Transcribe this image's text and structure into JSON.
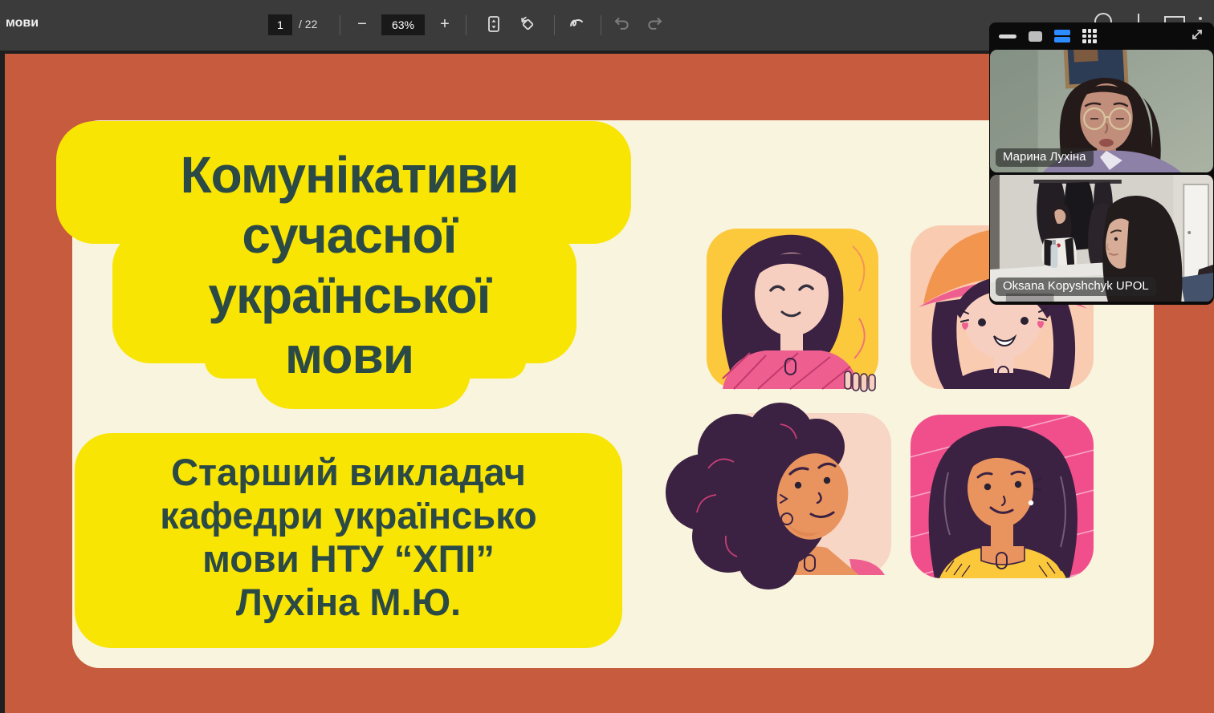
{
  "toolbar": {
    "doc_title_fragment": "мови",
    "page_input": "1",
    "page_total_label": "/ 22",
    "zoom_out_label": "−",
    "zoom_value": "63%",
    "zoom_in_label": "+",
    "icons": [
      "fit-to-page",
      "rotate",
      "draw",
      "undo",
      "redo",
      "search",
      "download",
      "print",
      "more"
    ]
  },
  "slide": {
    "title_lines": [
      "Комунікативи",
      "сучасної",
      "української",
      "мови"
    ],
    "subtitle_lines": [
      "Старший викладач",
      "кафедри українсько",
      "мови НТУ “ХПІ”",
      "Лухіна М.Ю."
    ],
    "illustration": "four-women-avatars"
  },
  "video_overlay": {
    "icons": [
      "minimize-view",
      "speaker-view",
      "side-by-side-view",
      "gallery-view",
      "expand"
    ],
    "participants": [
      {
        "name": "Марина Лухіна"
      },
      {
        "name": "Oksana Kopyshchyk UPOL"
      }
    ]
  },
  "colors": {
    "toolbar_bg": "#3b3b3b",
    "toolbar_box": "#191919",
    "page_orange": "#c75b3d",
    "slide_cream": "#f8f4de",
    "blob_yellow": "#f8e503",
    "title_teal": "#2b4a45",
    "zoom_accent_blue": "#2d8cff"
  }
}
